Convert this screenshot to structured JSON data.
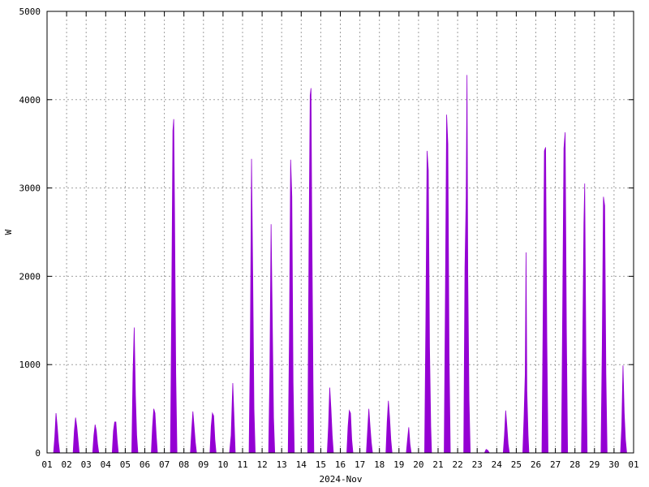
{
  "chart_data": {
    "type": "area",
    "xlabel": "2024-Nov",
    "ylabel": "W",
    "ylim": [
      0,
      5000
    ],
    "xlim": [
      "2024-11-01",
      "2024-12-01"
    ],
    "yticks": [
      0,
      1000,
      2000,
      3000,
      4000,
      5000
    ],
    "xtick_labels": [
      "01",
      "02",
      "03",
      "04",
      "05",
      "06",
      "07",
      "08",
      "09",
      "10",
      "11",
      "12",
      "13",
      "14",
      "15",
      "16",
      "17",
      "18",
      "19",
      "20",
      "21",
      "22",
      "23",
      "24",
      "25",
      "26",
      "27",
      "28",
      "29",
      "30",
      "01"
    ],
    "grid": true,
    "color": "#9400d3",
    "series": [
      {
        "daily_profiles": [
          {
            "day": "2024-11-01",
            "points": [
              [
                8,
                0
              ],
              [
                9.5,
                180
              ],
              [
                11,
                450
              ],
              [
                12.5,
                300
              ],
              [
                14,
                120
              ],
              [
                15.5,
                0
              ]
            ]
          },
          {
            "day": "2024-11-02",
            "points": [
              [
                8,
                0
              ],
              [
                9.5,
                250
              ],
              [
                11,
                400
              ],
              [
                12.5,
                300
              ],
              [
                14,
                150
              ],
              [
                15.5,
                0
              ]
            ]
          },
          {
            "day": "2024-11-03",
            "points": [
              [
                8,
                0
              ],
              [
                9.5,
                200
              ],
              [
                11,
                320
              ],
              [
                12.5,
                250
              ],
              [
                14,
                100
              ],
              [
                15.5,
                0
              ]
            ]
          },
          {
            "day": "2024-11-04",
            "points": [
              [
                8,
                0
              ],
              [
                9.5,
                250
              ],
              [
                11,
                350
              ],
              [
                12.5,
                350
              ],
              [
                14,
                150
              ],
              [
                15.5,
                0
              ]
            ]
          },
          {
            "day": "2024-11-05",
            "points": [
              [
                8,
                0
              ],
              [
                9.5,
                900
              ],
              [
                11,
                1420
              ],
              [
                12.5,
                650
              ],
              [
                14,
                200
              ],
              [
                15.5,
                0
              ]
            ]
          },
          {
            "day": "2024-11-06",
            "points": [
              [
                8,
                0
              ],
              [
                9.5,
                300
              ],
              [
                11,
                500
              ],
              [
                12.5,
                450
              ],
              [
                14,
                200
              ],
              [
                15.5,
                0
              ]
            ]
          },
          {
            "day": "2024-11-07",
            "points": [
              [
                7.5,
                0
              ],
              [
                9,
                1700
              ],
              [
                10.5,
                3650
              ],
              [
                11.5,
                3780
              ],
              [
                12.5,
                2750
              ],
              [
                14,
                900
              ],
              [
                15.5,
                0
              ]
            ]
          },
          {
            "day": "2024-11-08",
            "points": [
              [
                8,
                0
              ],
              [
                9.5,
                250
              ],
              [
                11,
                470
              ],
              [
                12.5,
                300
              ],
              [
                14,
                120
              ],
              [
                15.5,
                0
              ]
            ]
          },
          {
            "day": "2024-11-09",
            "points": [
              [
                8,
                0
              ],
              [
                9.5,
                300
              ],
              [
                11,
                450
              ],
              [
                12.5,
                420
              ],
              [
                14,
                150
              ],
              [
                15.5,
                0
              ]
            ]
          },
          {
            "day": "2024-11-10",
            "points": [
              [
                8,
                0
              ],
              [
                10,
                200
              ],
              [
                12,
                790
              ],
              [
                13.5,
                400
              ],
              [
                15,
                0
              ]
            ]
          },
          {
            "day": "2024-11-11",
            "points": [
              [
                8,
                0
              ],
              [
                9.5,
                1200
              ],
              [
                11,
                3330
              ],
              [
                12.5,
                2000
              ],
              [
                14,
                500
              ],
              [
                15.5,
                0
              ]
            ]
          },
          {
            "day": "2024-11-12",
            "points": [
              [
                8,
                0
              ],
              [
                9.5,
                900
              ],
              [
                11,
                2590
              ],
              [
                12.5,
                1500
              ],
              [
                14,
                400
              ],
              [
                15.5,
                0
              ]
            ]
          },
          {
            "day": "2024-11-13",
            "points": [
              [
                8,
                0
              ],
              [
                9.5,
                1300
              ],
              [
                11,
                3320
              ],
              [
                12.5,
                2900
              ],
              [
                14,
                800
              ],
              [
                15.5,
                0
              ]
            ]
          },
          {
            "day": "2024-11-14",
            "points": [
              [
                8,
                0
              ],
              [
                9.5,
                2300
              ],
              [
                11,
                4050
              ],
              [
                12,
                4130
              ],
              [
                13,
                2600
              ],
              [
                14.5,
                800
              ],
              [
                15.5,
                0
              ]
            ]
          },
          {
            "day": "2024-11-15",
            "points": [
              [
                8,
                0
              ],
              [
                9.5,
                300
              ],
              [
                11,
                740
              ],
              [
                12.5,
                500
              ],
              [
                14,
                200
              ],
              [
                15.5,
                0
              ]
            ]
          },
          {
            "day": "2024-11-16",
            "points": [
              [
                8,
                0
              ],
              [
                9.5,
                300
              ],
              [
                11,
                480
              ],
              [
                12.5,
                450
              ],
              [
                14,
                150
              ],
              [
                15.5,
                0
              ]
            ]
          },
          {
            "day": "2024-11-17",
            "points": [
              [
                8,
                0
              ],
              [
                9.5,
                250
              ],
              [
                11,
                500
              ],
              [
                12.5,
                300
              ],
              [
                14,
                120
              ],
              [
                15.5,
                0
              ]
            ]
          },
          {
            "day": "2024-11-18",
            "points": [
              [
                8,
                0
              ],
              [
                9.5,
                350
              ],
              [
                11,
                590
              ],
              [
                12.5,
                400
              ],
              [
                14,
                150
              ],
              [
                15.5,
                0
              ]
            ]
          },
          {
            "day": "2024-11-19",
            "points": [
              [
                9,
                0
              ],
              [
                10.5,
                150
              ],
              [
                12,
                290
              ],
              [
                13.5,
                100
              ],
              [
                15,
                0
              ]
            ]
          },
          {
            "day": "2024-11-20",
            "points": [
              [
                7.5,
                0
              ],
              [
                9,
                1500
              ],
              [
                10.5,
                3420
              ],
              [
                12,
                3200
              ],
              [
                13.5,
                1200
              ],
              [
                15,
                300
              ],
              [
                16,
                0
              ]
            ]
          },
          {
            "day": "2024-11-21",
            "points": [
              [
                7.5,
                0
              ],
              [
                9,
                1800
              ],
              [
                10.5,
                3830
              ],
              [
                12,
                3500
              ],
              [
                13.5,
                1100
              ],
              [
                15,
                0
              ]
            ]
          },
          {
            "day": "2024-11-22",
            "points": [
              [
                7.5,
                0
              ],
              [
                9,
                2100
              ],
              [
                10.5,
                2900
              ],
              [
                11.5,
                4280
              ],
              [
                12.5,
                2000
              ],
              [
                14,
                600
              ],
              [
                15.5,
                0
              ]
            ]
          },
          {
            "day": "2024-11-23",
            "points": [
              [
                9,
                0
              ],
              [
                11,
                40
              ],
              [
                13,
                30
              ],
              [
                15,
                0
              ]
            ]
          },
          {
            "day": "2024-11-24",
            "points": [
              [
                8,
                0
              ],
              [
                9.5,
                200
              ],
              [
                11,
                480
              ],
              [
                12.5,
                300
              ],
              [
                14,
                100
              ],
              [
                15.5,
                0
              ]
            ]
          },
          {
            "day": "2024-11-25",
            "points": [
              [
                8,
                0
              ],
              [
                9.5,
                400
              ],
              [
                11,
                900
              ],
              [
                12,
                2270
              ],
              [
                13,
                700
              ],
              [
                14.5,
                200
              ],
              [
                15.5,
                0
              ]
            ]
          },
          {
            "day": "2024-11-26",
            "points": [
              [
                7.5,
                0
              ],
              [
                9,
                1600
              ],
              [
                10.5,
                3420
              ],
              [
                12,
                3460
              ],
              [
                13.5,
                1300
              ],
              [
                15,
                0
              ]
            ]
          },
          {
            "day": "2024-11-27",
            "points": [
              [
                7.5,
                0
              ],
              [
                9,
                1700
              ],
              [
                10.5,
                3450
              ],
              [
                12,
                3630
              ],
              [
                13.5,
                1400
              ],
              [
                15,
                0
              ]
            ]
          },
          {
            "day": "2024-11-28",
            "points": [
              [
                8,
                0
              ],
              [
                9.5,
                1200
              ],
              [
                11,
                2600
              ],
              [
                12,
                3050
              ],
              [
                13.5,
                1100
              ],
              [
                15,
                0
              ]
            ]
          },
          {
            "day": "2024-11-29",
            "points": [
              [
                8,
                0
              ],
              [
                9.5,
                1200
              ],
              [
                11,
                2900
              ],
              [
                12.5,
                2800
              ],
              [
                14,
                900
              ],
              [
                15.5,
                0
              ]
            ]
          },
          {
            "day": "2024-11-30",
            "points": [
              [
                8,
                0
              ],
              [
                9.5,
                300
              ],
              [
                11,
                990
              ],
              [
                12.5,
                450
              ],
              [
                14,
                150
              ],
              [
                15.5,
                0
              ]
            ]
          }
        ]
      }
    ]
  }
}
